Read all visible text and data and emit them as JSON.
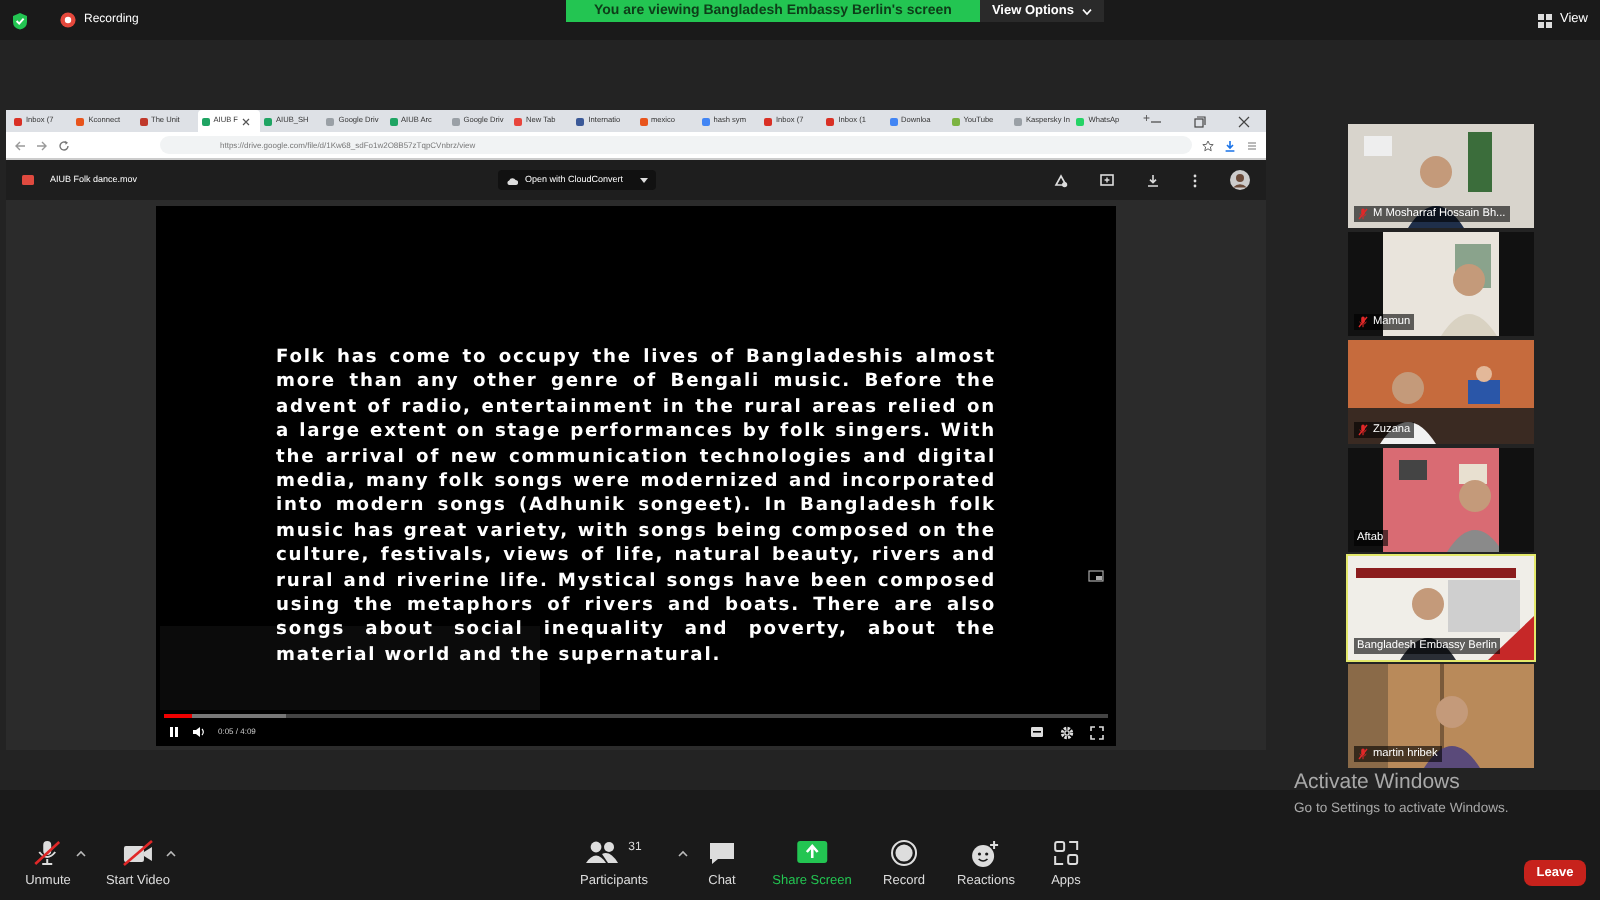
{
  "top_bar": {
    "recording_label": "Recording",
    "banner": "You are viewing Bangladesh Embassy Berlin's screen",
    "view_options": "View Options",
    "view": "View"
  },
  "browser": {
    "tabs": [
      {
        "label": "Inbox (7",
        "selected": false,
        "color": "#d93025"
      },
      {
        "label": "Kconnect",
        "selected": false,
        "color": "#e8541c"
      },
      {
        "label": "The Unit",
        "selected": false,
        "color": "#c0392b"
      },
      {
        "label": "AIUB F",
        "selected": true,
        "color": "#1fa463"
      },
      {
        "label": "AIUB_SH",
        "selected": false,
        "color": "#1fa463"
      },
      {
        "label": "Google Driv",
        "selected": false,
        "color": "#9aa0a6"
      },
      {
        "label": "AIUB Arc",
        "selected": false,
        "color": "#1fa463"
      },
      {
        "label": "Google Driv",
        "selected": false,
        "color": "#9aa0a6"
      },
      {
        "label": "New Tab",
        "selected": false,
        "color": "#e8453c"
      },
      {
        "label": "Internatio",
        "selected": false,
        "color": "#3b5998"
      },
      {
        "label": "mexico",
        "selected": false,
        "color": "#e8541c"
      },
      {
        "label": "hash sym",
        "selected": false,
        "color": "#4285f4"
      },
      {
        "label": "Inbox (7",
        "selected": false,
        "color": "#d93025"
      },
      {
        "label": "Inbox (1",
        "selected": false,
        "color": "#d93025"
      },
      {
        "label": "Downloa",
        "selected": false,
        "color": "#4285f4"
      },
      {
        "label": "YouTube",
        "selected": false,
        "color": "#7cb342"
      },
      {
        "label": "Kaspersky In",
        "selected": false,
        "color": "#9aa0a6"
      },
      {
        "label": "WhatsAp",
        "selected": false,
        "color": "#25d366"
      }
    ],
    "new_tab": "+",
    "url": "https://drive.google.com/file/d/1Kw68_sdFo1w2O8B57zTqpCVnbrz/view"
  },
  "drive": {
    "file_name": "AIUB Folk dance.mov",
    "open_with": "Open with CloudConvert"
  },
  "video": {
    "caption": "Folk has come to occupy the lives of Bangladeshis almost more than any other genre of Bengali music. Before the advent of radio, entertainment in the rural areas relied on a large extent on stage performances by folk singers. With the arrival of new communication technologies and digital media, many folk songs were modernized and incorporated into modern songs (Adhunik songeet). In Bangladesh folk music has great variety, with songs being composed on the culture, festivals, views of life, natural beauty, rivers and rural and riverine life. Mystical songs have been composed using the metaphors of rivers and boats. There are also songs about social inequality and poverty, about the material world and the supernatural.",
    "buffer": {
      "level": 0.13
    },
    "progress": {
      "level": 0.03
    },
    "time": "0:05 / 4:09"
  },
  "participants": [
    {
      "name": "M Mosharraf Hossain Bh...",
      "muted": true,
      "speaking": false
    },
    {
      "name": "Mamun",
      "muted": true,
      "speaking": false
    },
    {
      "name": "Zuzana",
      "muted": true,
      "speaking": false
    },
    {
      "name": "Aftab",
      "muted": false,
      "speaking": false
    },
    {
      "name": "Bangladesh Embassy Berlin",
      "muted": false,
      "speaking": true
    },
    {
      "name": "martin hribek",
      "muted": true,
      "speaking": false
    }
  ],
  "watermark": {
    "title": "Activate Windows",
    "hint": "Go to Settings to activate Windows."
  },
  "toolbar": {
    "buttons": [
      {
        "label": "Unmute",
        "kind": "mic",
        "off": true,
        "caret": true
      },
      {
        "label": "Start Video",
        "kind": "video",
        "off": true,
        "caret": true
      },
      {
        "label": "Participants",
        "kind": "participants",
        "count": "31",
        "caret": true
      },
      {
        "label": "Chat",
        "kind": "chat"
      },
      {
        "label": "Share Screen",
        "kind": "share"
      },
      {
        "label": "Record",
        "kind": "record"
      },
      {
        "label": "Reactions",
        "kind": "reactions"
      },
      {
        "label": "Apps",
        "kind": "apps"
      }
    ],
    "leave": "Leave"
  }
}
